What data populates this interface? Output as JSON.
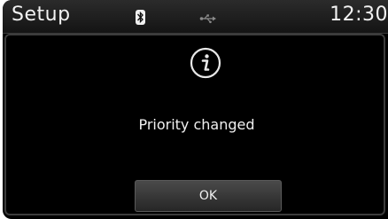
{
  "header": {
    "title": "Setup",
    "time": "12:30",
    "status_icons": [
      "bluetooth-icon",
      "usb-icon"
    ]
  },
  "dialog": {
    "icon": "info-icon",
    "message": "Priority changed",
    "ok_label": "OK"
  },
  "colors": {
    "background": "#000000",
    "text": "#f0f0f0",
    "button": "#3a3a3a"
  }
}
